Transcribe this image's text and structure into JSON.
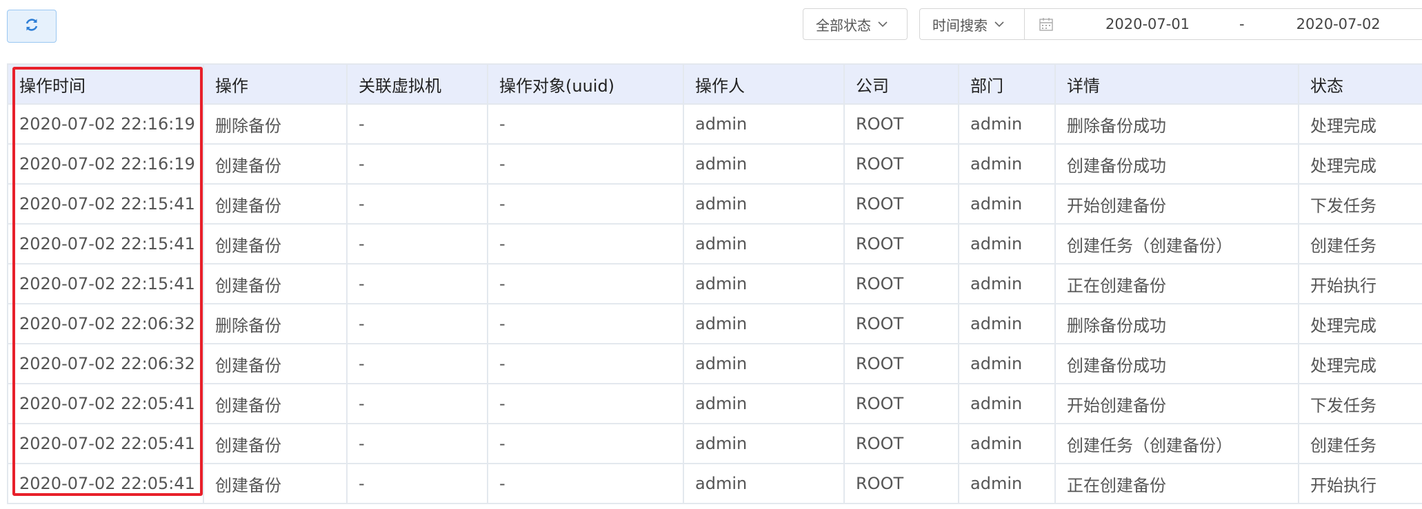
{
  "toolbar": {
    "refresh_icon": "refresh-icon",
    "status_filter": {
      "label": "全部状态",
      "icon": "chevron-down-icon"
    },
    "time_filter": {
      "type_label": "时间搜索",
      "calendar_icon": "calendar-icon",
      "start_date": "2020-07-01",
      "separator": "-",
      "end_date": "2020-07-02"
    }
  },
  "colors": {
    "accent": "#2f7fd6",
    "highlight": "#e8202a",
    "header_bg": "#e8edfb"
  },
  "table": {
    "columns": [
      "操作时间",
      "操作",
      "关联虚拟机",
      "操作对象(uuid)",
      "操作人",
      "公司",
      "部门",
      "详情",
      "状态"
    ],
    "rows": [
      [
        "2020-07-02 22:16:19",
        "删除备份",
        "-",
        "-",
        "admin",
        "ROOT",
        "admin",
        "删除备份成功",
        "处理完成"
      ],
      [
        "2020-07-02 22:16:19",
        "创建备份",
        "-",
        "-",
        "admin",
        "ROOT",
        "admin",
        "创建备份成功",
        "处理完成"
      ],
      [
        "2020-07-02 22:15:41",
        "创建备份",
        "-",
        "-",
        "admin",
        "ROOT",
        "admin",
        "开始创建备份",
        "下发任务"
      ],
      [
        "2020-07-02 22:15:41",
        "创建备份",
        "-",
        "-",
        "admin",
        "ROOT",
        "admin",
        "创建任务（创建备份）",
        "创建任务"
      ],
      [
        "2020-07-02 22:15:41",
        "创建备份",
        "-",
        "-",
        "admin",
        "ROOT",
        "admin",
        "正在创建备份",
        "开始执行"
      ],
      [
        "2020-07-02 22:06:32",
        "删除备份",
        "-",
        "-",
        "admin",
        "ROOT",
        "admin",
        "删除备份成功",
        "处理完成"
      ],
      [
        "2020-07-02 22:06:32",
        "创建备份",
        "-",
        "-",
        "admin",
        "ROOT",
        "admin",
        "创建备份成功",
        "处理完成"
      ],
      [
        "2020-07-02 22:05:41",
        "创建备份",
        "-",
        "-",
        "admin",
        "ROOT",
        "admin",
        "开始创建备份",
        "下发任务"
      ],
      [
        "2020-07-02 22:05:41",
        "创建备份",
        "-",
        "-",
        "admin",
        "ROOT",
        "admin",
        "创建任务（创建备份）",
        "创建任务"
      ],
      [
        "2020-07-02 22:05:41",
        "创建备份",
        "-",
        "-",
        "admin",
        "ROOT",
        "admin",
        "正在创建备份",
        "开始执行"
      ]
    ]
  }
}
